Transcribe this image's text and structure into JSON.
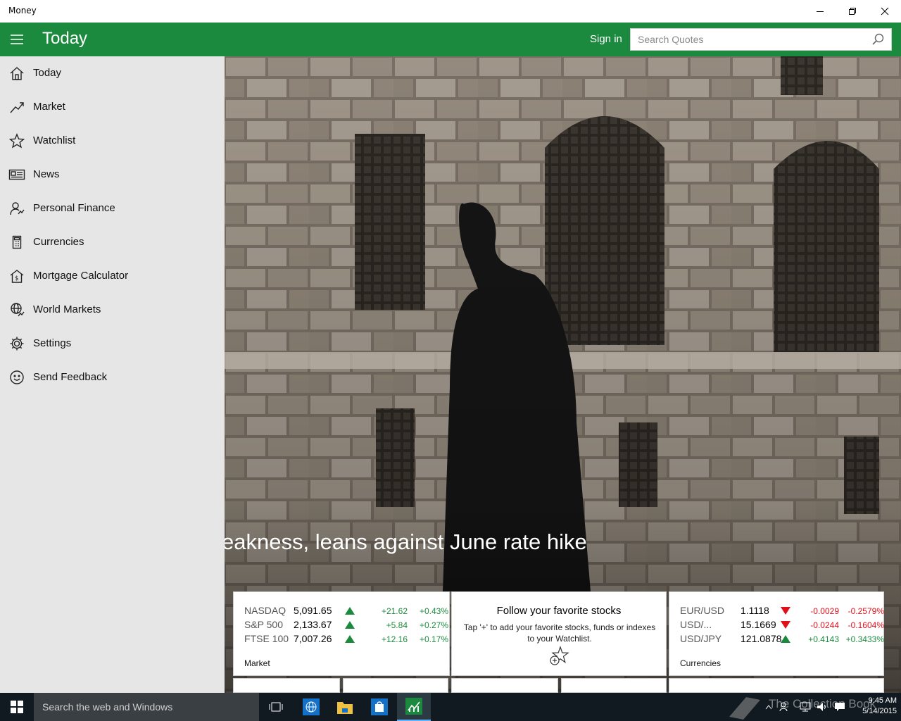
{
  "window": {
    "title": "Money",
    "controls": [
      "minimize",
      "restore",
      "close"
    ]
  },
  "appbar": {
    "page_title": "Today",
    "sign_in": "Sign in",
    "search_placeholder": "Search Quotes"
  },
  "nav": {
    "items": [
      {
        "label": "Today",
        "icon": "home-icon"
      },
      {
        "label": "Market",
        "icon": "trend-icon"
      },
      {
        "label": "Watchlist",
        "icon": "star-icon"
      },
      {
        "label": "News",
        "icon": "news-icon"
      },
      {
        "label": "Personal Finance",
        "icon": "personal-finance-icon"
      },
      {
        "label": "Currencies",
        "icon": "calculator-icon"
      },
      {
        "label": "Mortgage Calculator",
        "icon": "mortgage-icon"
      },
      {
        "label": "World Markets",
        "icon": "globe-icon"
      },
      {
        "label": "Settings",
        "icon": "gear-icon"
      },
      {
        "label": "Send Feedback",
        "icon": "smiley-icon"
      }
    ]
  },
  "hero": {
    "headline": "eakness, leans against June rate hike"
  },
  "market_tile": {
    "label": "Market",
    "rows": [
      {
        "name": "NASDAQ",
        "value": "5,091.65",
        "dir": "up",
        "change": "+21.62",
        "pct": "+0.43%"
      },
      {
        "name": "S&P 500",
        "value": "2,133.67",
        "dir": "up",
        "change": "+5.84",
        "pct": "+0.27%"
      },
      {
        "name": "FTSE 100",
        "value": "7,007.26",
        "dir": "up",
        "change": "+12.16",
        "pct": "+0.17%"
      }
    ]
  },
  "follow_tile": {
    "title": "Follow your favorite stocks",
    "description": "Tap '+' to add your favorite stocks, funds or indexes to your Watchlist."
  },
  "currencies_tile": {
    "label": "Currencies",
    "rows": [
      {
        "name": "EUR/USD",
        "value": "1.1118",
        "dir": "down",
        "change": "-0.0029",
        "pct": "-0.2579%"
      },
      {
        "name": "USD/...",
        "value": "15.1669",
        "dir": "down",
        "change": "-0.0244",
        "pct": "-0.1604%"
      },
      {
        "name": "USD/JPY",
        "value": "121.0878",
        "dir": "up",
        "change": "+0.4143",
        "pct": "+0.3433%"
      }
    ]
  },
  "taskbar": {
    "search_text": "Search the web and Windows",
    "time": "9:45 AM",
    "date": "5/14/2015",
    "watermark": "The Collection Book"
  },
  "colors": {
    "accent": "#1c8a3e",
    "nav_bg": "#e6e6e6",
    "up": "#1c8a3e",
    "down": "#e0101a"
  }
}
